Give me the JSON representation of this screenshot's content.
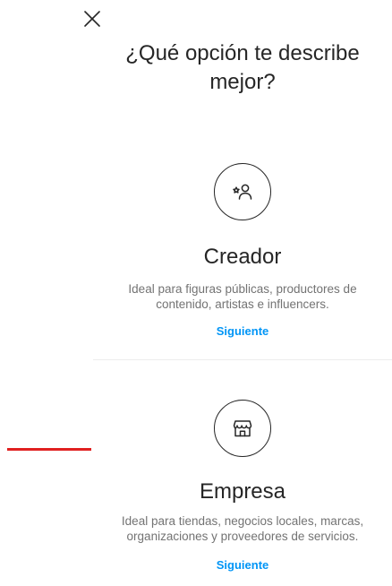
{
  "header": {
    "close_icon": "close-icon",
    "title": "¿Qué opción te describe mejor?"
  },
  "options": [
    {
      "icon": "creator-star-person-icon",
      "title": "Creador",
      "description": "Ideal para figuras públicas, productores de contenido, artistas e influencers.",
      "action_label": "Siguiente"
    },
    {
      "icon": "storefront-icon",
      "title": "Empresa",
      "description": "Ideal para tiendas, negocios locales, marcas, organizaciones y proveedores de servicios.",
      "action_label": "Siguiente"
    }
  ],
  "colors": {
    "text": "#262626",
    "secondary_text": "#737373",
    "link": "#0095f6",
    "divider": "#ededed",
    "marker": "#e02020"
  }
}
